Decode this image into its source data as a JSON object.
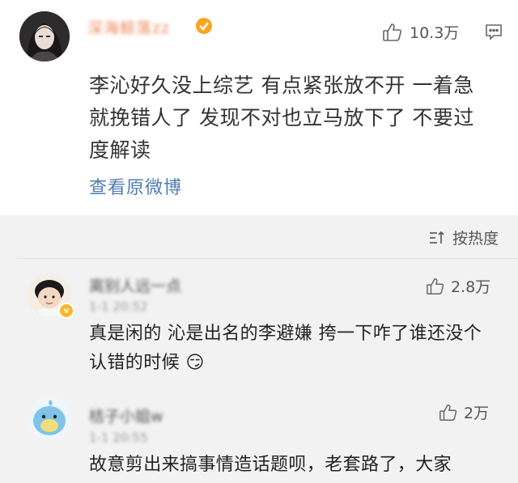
{
  "post": {
    "author": "深海鲸落zz",
    "likes": "10.3万",
    "text": "李沁好久没上综艺 有点紧张放不开 一着急就挽错人了 发现不对也立马放下了 不要过度解读",
    "view_original": "查看原微博"
  },
  "comments_header": {
    "sort_label": "按热度"
  },
  "comments": [
    {
      "name": "离别人远一点",
      "meta": "1-1 20:52",
      "likes": "2.8万",
      "text": "真是闲的 沁是出名的李避嫌 挎一下咋了谁还没个认错的时候 😏"
    },
    {
      "name": "桔子小姐w",
      "meta": "1-1 20:55",
      "likes": "2万",
      "text": "故意剪出来搞事情造话题呗，老套路了，大家"
    }
  ],
  "colors": {
    "link": "#4f7db2",
    "author": "#f08a5d",
    "section_bg": "#f2f2f2"
  }
}
